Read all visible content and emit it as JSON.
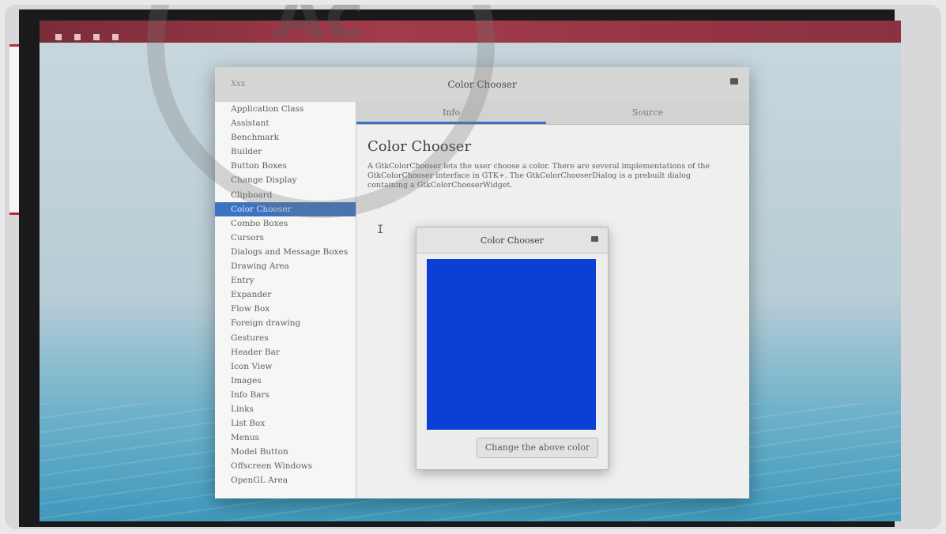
{
  "window": {
    "left_label": "Xxx",
    "title": "Color Chooser"
  },
  "sidebar": {
    "items": [
      "Application Class",
      "Assistant",
      "Benchmark",
      "Builder",
      "Button Boxes",
      "Change Display",
      "Clipboard",
      "Color Chooser",
      "Combo Boxes",
      "Cursors",
      "Dialogs and Message Boxes",
      "Drawing Area",
      "Entry",
      "Expander",
      "Flow Box",
      "Foreign drawing",
      "Gestures",
      "Header Bar",
      "Icon View",
      "Images",
      "Info Bars",
      "Links",
      "List Box",
      "Menus",
      "Model Button",
      "Offscreen Windows",
      "OpenGL Area"
    ],
    "selected_index": 7
  },
  "tabs": {
    "info": "Info",
    "source": "Source"
  },
  "content": {
    "heading": "Color Chooser",
    "description": "A GtkColorChooser lets the user choose a color. There are several implementations of the GtkColorChooser interface in GTK+. The GtkColorChooserDialog is a prebuilt dialog containing a GtkColorChooserWidget.",
    "cursor_glyph": "I"
  },
  "dialog": {
    "title": "Color Chooser",
    "swatch_color": "#0b3fd6",
    "button_label": "Change the above color"
  },
  "colors": {
    "selection": "#3b73c2",
    "topbar": "#a23b4a"
  },
  "watermark": {
    "text": "Ac"
  }
}
